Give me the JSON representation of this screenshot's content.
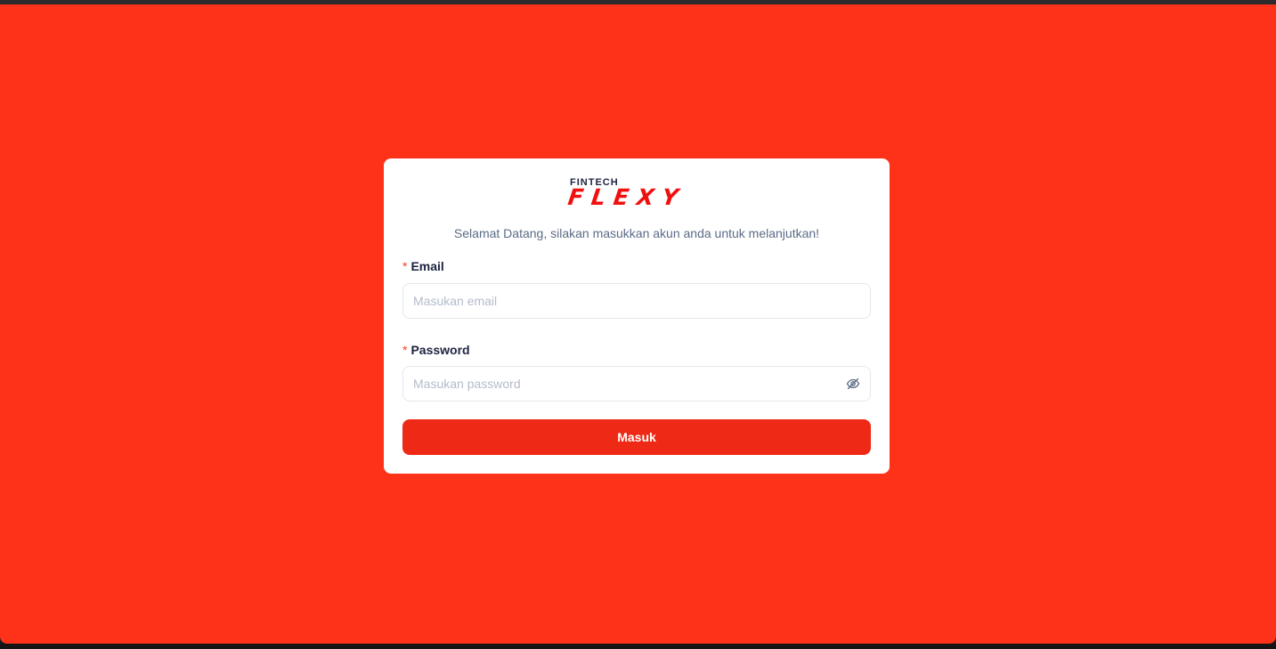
{
  "brand": {
    "small": "FINTECH",
    "big": "FLEXY"
  },
  "welcome_text": "Selamat Datang, silakan masukkan akun anda untuk melanjutkan!",
  "form": {
    "email": {
      "required_mark": "*",
      "label": "Email",
      "placeholder": "Masukan email",
      "value": ""
    },
    "password": {
      "required_mark": "*",
      "label": "Password",
      "placeholder": "Masukan password",
      "value": "",
      "toggle_icon": "eye-off-icon"
    },
    "submit_label": "Masuk"
  },
  "colors": {
    "background": "#fe3119",
    "button": "#ee2a16",
    "logo_red": "#f0100f",
    "logo_navy": "#1d2340"
  }
}
